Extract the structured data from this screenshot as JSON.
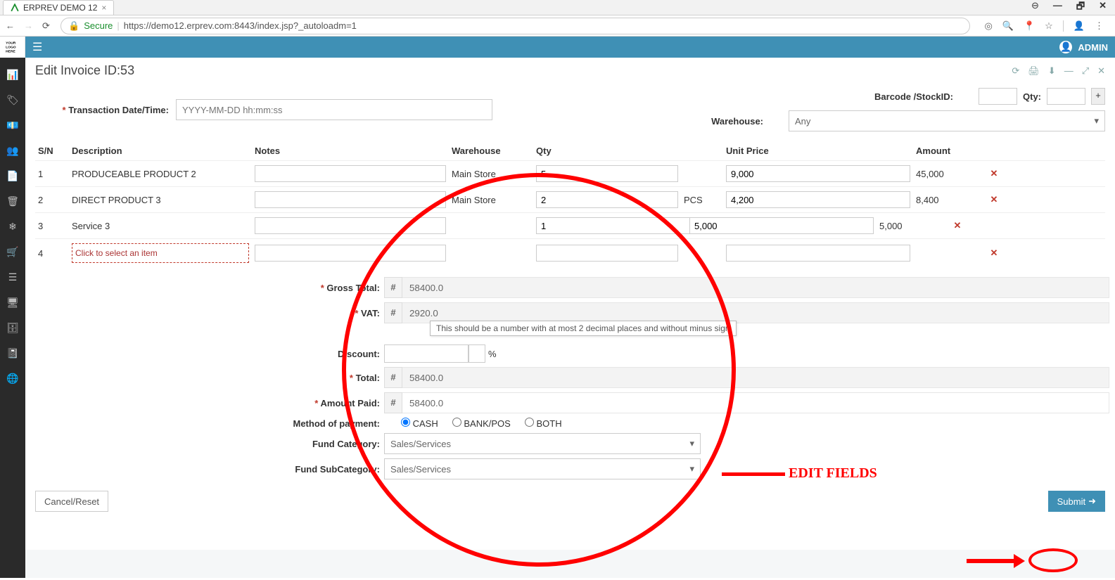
{
  "browser": {
    "tab_title": "ERPREV DEMO 12",
    "secure_label": "Secure",
    "url": "https://demo12.erprev.com:8443/index.jsp?_autoloadm=1",
    "win_minimize": "—",
    "win_restore": "🗗",
    "win_close": "✕"
  },
  "logo_text": "YOUR\nLOGO\nHERE",
  "topbar": {
    "user": "ADMIN"
  },
  "panel": {
    "title": "Edit Invoice ID:53"
  },
  "form": {
    "transaction_date_label": "Transaction Date/Time:",
    "transaction_date_placeholder": "YYYY-MM-DD hh:mm:ss",
    "barcode_label": "Barcode /StockID:",
    "qty_label": "Qty:",
    "plus": "+",
    "warehouse_label": "Warehouse:",
    "warehouse_value": "Any"
  },
  "table": {
    "headers": {
      "sn": "S/N",
      "desc": "Description",
      "notes": "Notes",
      "wh": "Warehouse",
      "qty": "Qty",
      "price": "Unit Price",
      "amount": "Amount"
    },
    "rows": [
      {
        "sn": "1",
        "desc": "PRODUCEABLE PRODUCT 2",
        "notes": "",
        "wh": "Main Store",
        "qty": "5",
        "unit": "",
        "price": "9,000",
        "amount": "45,000"
      },
      {
        "sn": "2",
        "desc": "DIRECT PRODUCT 3",
        "notes": "",
        "wh": "Main Store",
        "qty": "2",
        "unit": "PCS",
        "price": "4,200",
        "amount": "8,400"
      },
      {
        "sn": "3",
        "desc": "Service 3",
        "notes": "",
        "wh": "",
        "qty": "1",
        "unit": "",
        "price": "5,000",
        "amount": "5,000"
      }
    ],
    "placeholder_sn": "4",
    "placeholder_desc": "Click to select an item"
  },
  "totals": {
    "currency": "#",
    "gross_total_label": "Gross Total:",
    "gross_total": "58400.0",
    "vat_label": "VAT:",
    "vat": "2920.0",
    "vat_tooltip": "This should be a number with at most 2 decimal places and without minus sign",
    "discount_label": "Discount:",
    "discount": "",
    "discount_pct_sign": "%",
    "total_label": "Total:",
    "total": "58400.0",
    "amount_paid_label": "Amount Paid:",
    "amount_paid": "58400.0",
    "payment_method_label": "Method of payment:",
    "payment_options": {
      "cash": "CASH",
      "bank": "BANK/POS",
      "both": "BOTH"
    },
    "fund_category_label": "Fund Category:",
    "fund_category": "Sales/Services",
    "fund_subcategory_label": "Fund SubCategory:",
    "fund_subcategory": "Sales/Services"
  },
  "buttons": {
    "cancel": "Cancel/Reset",
    "submit": "Submit"
  },
  "annotation": {
    "label": "EDIT FIELDS"
  }
}
